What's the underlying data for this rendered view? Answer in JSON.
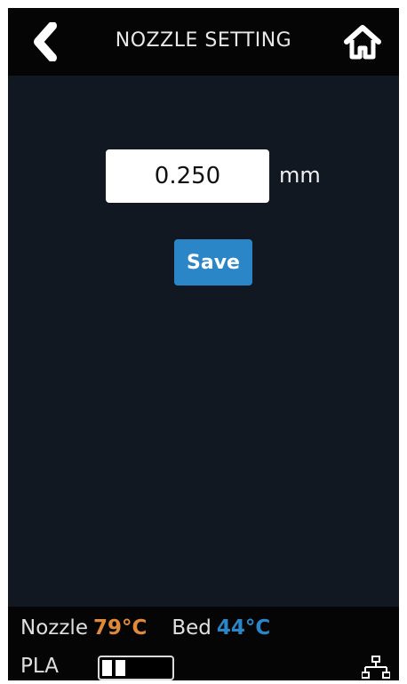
{
  "header": {
    "title": "NOZZLE SETTING",
    "back_icon": "chevron-left-icon",
    "home_icon": "home-icon"
  },
  "main": {
    "value": "0.250",
    "unit": "mm",
    "save_label": "Save"
  },
  "footer": {
    "nozzle_label": "Nozzle",
    "nozzle_temp": "79°C",
    "bed_label": "Bed",
    "bed_temp": "44°C",
    "filament": "PLA",
    "filament_level": 0.25,
    "network_icon": "network-icon"
  },
  "colors": {
    "background": "#111822",
    "bar": "#050505",
    "accent": "#2b86c8",
    "nozzle": "#e08a3a"
  }
}
